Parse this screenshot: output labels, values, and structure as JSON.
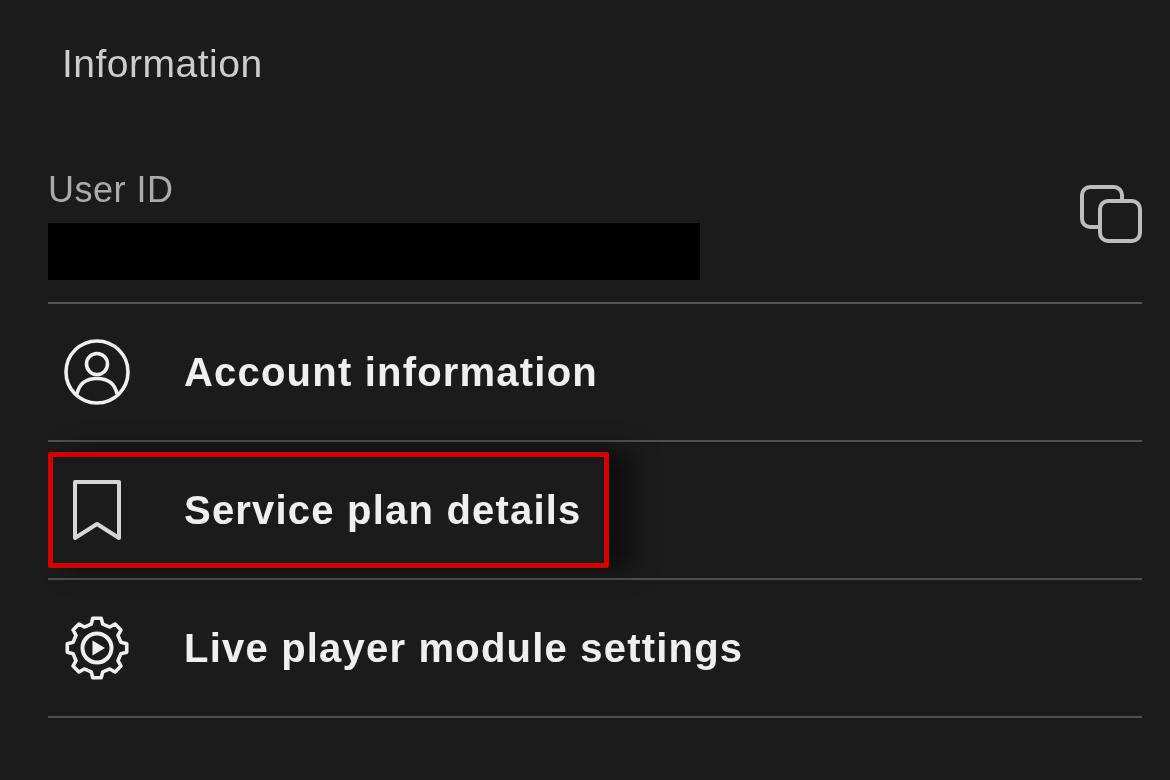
{
  "section_title": "Information",
  "user_id": {
    "label": "User ID",
    "value_redacted": true
  },
  "menu_items": [
    {
      "kind": "account",
      "label": "Account information",
      "highlighted": false
    },
    {
      "kind": "plan",
      "label": "Service plan details",
      "highlighted": true
    },
    {
      "kind": "player_settings",
      "label": "Live player module settings",
      "highlighted": false
    }
  ]
}
